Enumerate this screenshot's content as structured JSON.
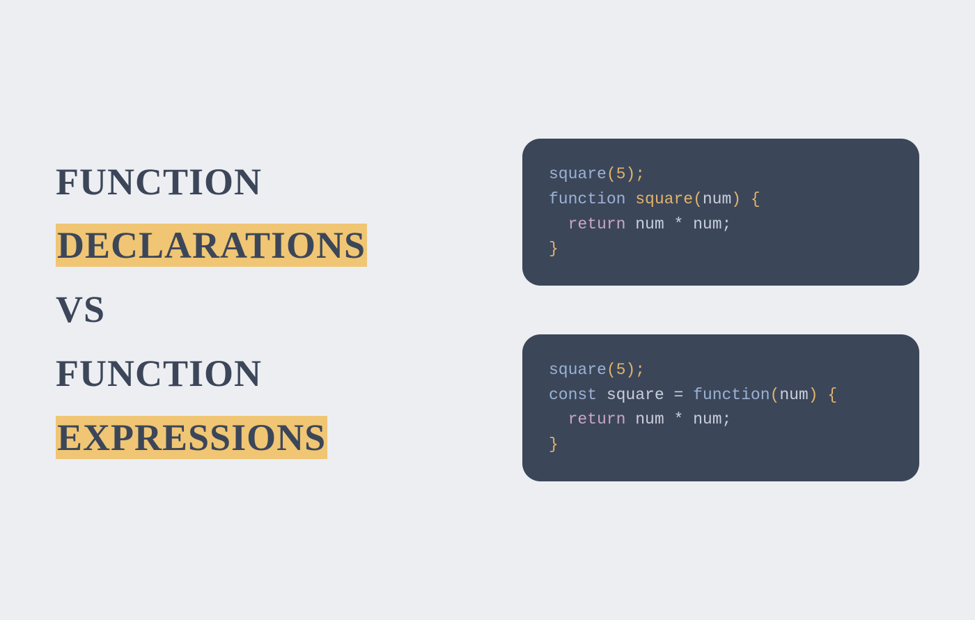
{
  "heading": {
    "line1": "FUNCTION",
    "line2": "DECLARATIONS",
    "line3": "VS",
    "line4": "FUNCTION",
    "line5": "EXPRESSIONS"
  },
  "code": {
    "block1": {
      "l1_call": "square",
      "l1_open": "(",
      "l1_arg": "5",
      "l1_close": ");",
      "l2_kw": "function",
      "l2_sp1": " ",
      "l2_name": "square",
      "l2_open": "(",
      "l2_param": "num",
      "l2_close": ")",
      "l2_sp2": " ",
      "l2_brace": "{",
      "l3_indent": "  ",
      "l3_return": "return",
      "l3_sp1": " ",
      "l3_a": "num",
      "l3_sp2": " ",
      "l3_op": "*",
      "l3_sp3": " ",
      "l3_b": "num",
      "l3_semi": ";",
      "l4_brace": "}"
    },
    "block2": {
      "l1_call": "square",
      "l1_open": "(",
      "l1_arg": "5",
      "l1_close": ");",
      "l2_kw": "const",
      "l2_sp1": " ",
      "l2_name": "square",
      "l2_sp2": " ",
      "l2_eq": "=",
      "l2_sp3": " ",
      "l2_fn": "function",
      "l2_open": "(",
      "l2_param": "num",
      "l2_close": ")",
      "l2_sp4": " ",
      "l2_brace": "{",
      "l3_indent": "  ",
      "l3_return": "return",
      "l3_sp1": " ",
      "l3_a": "num",
      "l3_sp2": " ",
      "l3_op": "*",
      "l3_sp3": " ",
      "l3_b": "num",
      "l3_semi": ";",
      "l4_brace": "}"
    }
  }
}
